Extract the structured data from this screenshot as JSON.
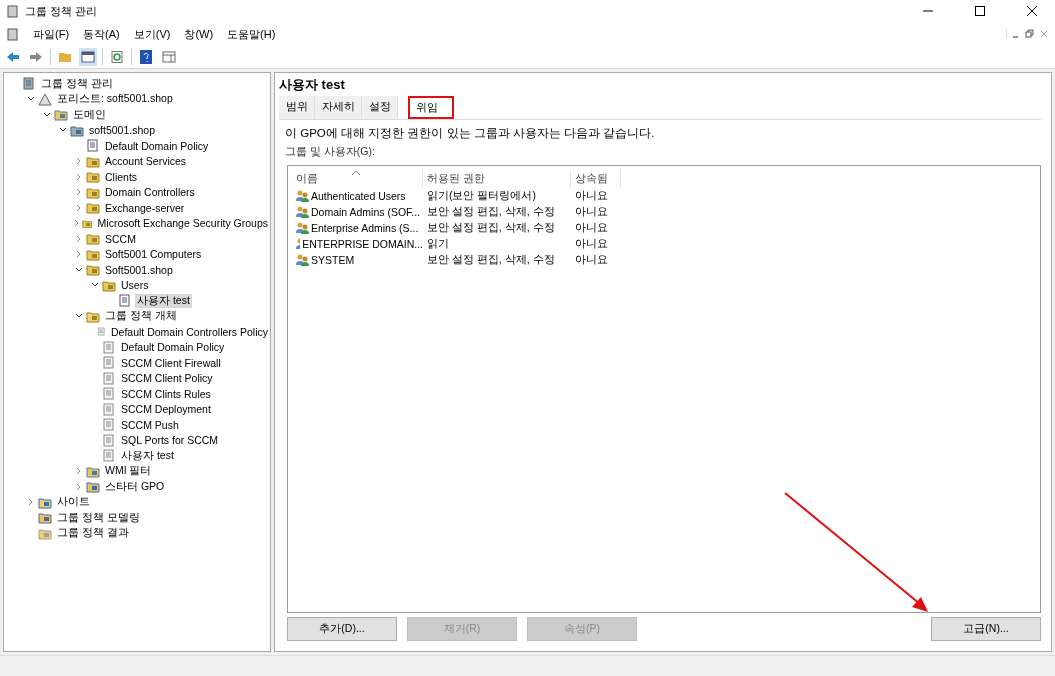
{
  "window": {
    "title": "그룹 정책 관리"
  },
  "menu": [
    "파일(F)",
    "동작(A)",
    "보기(V)",
    "창(W)",
    "도움말(H)"
  ],
  "tree": [
    {
      "label": "그룹 정책 관리",
      "kind": "console",
      "selected": false,
      "children": [
        {
          "label": "포리스트: soft5001.shop",
          "kind": "forest",
          "expanded": true,
          "selected": false,
          "children": [
            {
              "label": "도메인",
              "kind": "domains",
              "expanded": true,
              "selected": false,
              "children": [
                {
                  "label": "soft5001.shop",
                  "kind": "domain",
                  "expanded": true,
                  "selected": false,
                  "children": [
                    {
                      "label": "Default Domain Policy",
                      "kind": "gpo-link",
                      "selected": false
                    },
                    {
                      "label": "Account Services",
                      "kind": "ou",
                      "expanded": false,
                      "selected": false
                    },
                    {
                      "label": "Clients",
                      "kind": "ou",
                      "expanded": false,
                      "selected": false
                    },
                    {
                      "label": "Domain Controllers",
                      "kind": "ou",
                      "expanded": false,
                      "selected": false
                    },
                    {
                      "label": "Exchange-server",
                      "kind": "ou",
                      "expanded": false,
                      "selected": false
                    },
                    {
                      "label": "Microsoft Exchange Security Groups",
                      "kind": "ou",
                      "expanded": false,
                      "selected": false
                    },
                    {
                      "label": "SCCM",
                      "kind": "ou",
                      "expanded": false,
                      "selected": false
                    },
                    {
                      "label": "Soft5001 Computers",
                      "kind": "ou",
                      "expanded": false,
                      "selected": false
                    },
                    {
                      "label": "Soft5001.shop",
                      "kind": "ou",
                      "expanded": true,
                      "selected": false,
                      "children": [
                        {
                          "label": "Users",
                          "kind": "ou",
                          "expanded": true,
                          "selected": false,
                          "children": [
                            {
                              "label": "사용자 test",
                              "kind": "gpo-link",
                              "selected": true
                            }
                          ]
                        }
                      ]
                    },
                    {
                      "label": "그룹 정책 개체",
                      "kind": "gpo-folder",
                      "expanded": true,
                      "selected": false,
                      "children": [
                        {
                          "label": "Default Domain Controllers Policy",
                          "kind": "gpo",
                          "selected": false
                        },
                        {
                          "label": "Default Domain Policy",
                          "kind": "gpo",
                          "selected": false
                        },
                        {
                          "label": "SCCM Client Firewall",
                          "kind": "gpo",
                          "selected": false
                        },
                        {
                          "label": "SCCM Client Policy",
                          "kind": "gpo",
                          "selected": false
                        },
                        {
                          "label": "SCCM Clints Rules",
                          "kind": "gpo",
                          "selected": false
                        },
                        {
                          "label": "SCCM Deployment",
                          "kind": "gpo",
                          "selected": false
                        },
                        {
                          "label": "SCCM Push",
                          "kind": "gpo",
                          "selected": false
                        },
                        {
                          "label": "SQL Ports for SCCM",
                          "kind": "gpo",
                          "selected": false
                        },
                        {
                          "label": "사용자 test",
                          "kind": "gpo",
                          "selected": false
                        }
                      ]
                    },
                    {
                      "label": "WMI 필터",
                      "kind": "wmi",
                      "expanded": false,
                      "selected": false
                    },
                    {
                      "label": "스타터 GPO",
                      "kind": "starter",
                      "expanded": false,
                      "selected": false
                    }
                  ]
                }
              ]
            }
          ]
        },
        {
          "label": "사이트",
          "kind": "sites",
          "expanded": false,
          "selected": false
        },
        {
          "label": "그룹 정책 모델링",
          "kind": "modeling",
          "selected": false
        },
        {
          "label": "그룹 정책 결과",
          "kind": "results",
          "selected": false
        }
      ]
    }
  ],
  "detail": {
    "title": "사용자 test",
    "tabs": [
      {
        "label": "범위",
        "selected": false,
        "highlighted": false
      },
      {
        "label": "자세히",
        "selected": false,
        "highlighted": false
      },
      {
        "label": "설정",
        "selected": false,
        "highlighted": false
      },
      {
        "label": "위임",
        "selected": true,
        "highlighted": true
      }
    ],
    "description": "이 GPO에 대해 지정한 권한이 있는 그룹과 사용자는 다음과 같습니다.",
    "list_label": "그룹 및 사용자(G):",
    "columns": [
      "이름",
      "허용된 권한",
      "상속됨"
    ],
    "rows": [
      [
        "Authenticated Users",
        "읽기(보안 필터링에서)",
        "아니요"
      ],
      [
        "Domain Admins (SOF...",
        "보안 설정 편집, 삭제, 수정",
        "아니요"
      ],
      [
        "Enterprise Admins (S...",
        "보안 설정 편집, 삭제, 수정",
        "아니요"
      ],
      [
        "ENTERPRISE DOMAIN...",
        "읽기",
        "아니요"
      ],
      [
        "SYSTEM",
        "보안 설정 편집, 삭제, 수정",
        "아니요"
      ]
    ],
    "buttons": [
      {
        "label": "추가(D)...",
        "disabled": false
      },
      {
        "label": "제거(R)",
        "disabled": true
      },
      {
        "label": "속성(P)",
        "disabled": true
      },
      {
        "label": "고급(N)...",
        "disabled": false
      }
    ]
  }
}
